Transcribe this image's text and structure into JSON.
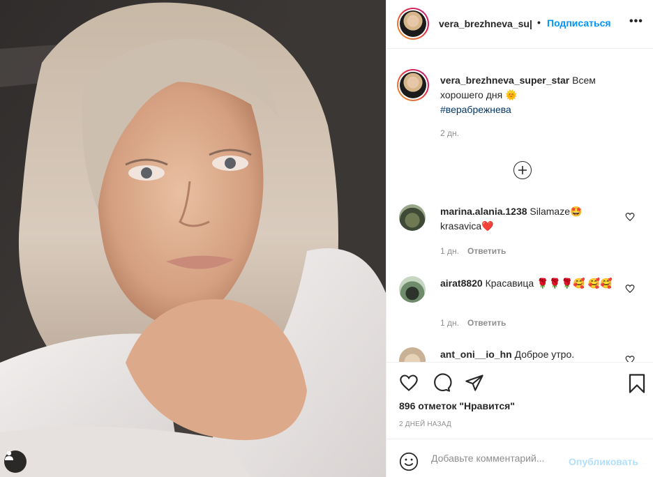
{
  "post": {
    "username": "vera_brezhneva_super_star",
    "header_username_display": "vera_brezhneva_su|",
    "separator": "•",
    "follow_label": "Подписаться",
    "more_label": "•••"
  },
  "caption": {
    "username": "vera_brezhneva_super_star",
    "text": "Всем хорошего дня",
    "emoji": "🌞",
    "hashtag": "#верабрежнева",
    "time": "2 дн."
  },
  "comments": [
    {
      "username": "marina.alania.1238",
      "text": "Silamaze🤩 krasavica❤️",
      "time": "1 дн.",
      "reply_label": "Ответить"
    },
    {
      "username": "airat8820",
      "text": "Красавица 🌹🌹🌹🥰 🥰🥰",
      "time": "1 дн.",
      "reply_label": "Ответить"
    },
    {
      "username": "ant_oni__io_hn",
      "text": "Доброе утро.",
      "time": "",
      "reply_label": ""
    }
  ],
  "stats": {
    "likes": "896 отметок \"Нравится\"",
    "posted": "2 ДНЕЙ НАЗАД"
  },
  "compose": {
    "placeholder": "Добавьте комментарий...",
    "publish_label": "Опубликовать"
  },
  "icons": {
    "like": "heart-icon",
    "comment": "comment-icon",
    "share": "paper-plane-icon",
    "save": "bookmark-icon",
    "emoji": "smiley-icon",
    "load_more": "plus-circle-icon",
    "user_tag": "user-icon"
  },
  "colors": {
    "accent": "#0095f6",
    "publish_disabled": "#b2dffc",
    "meta": "#8e8e8e",
    "hashtag": "#00376b"
  }
}
